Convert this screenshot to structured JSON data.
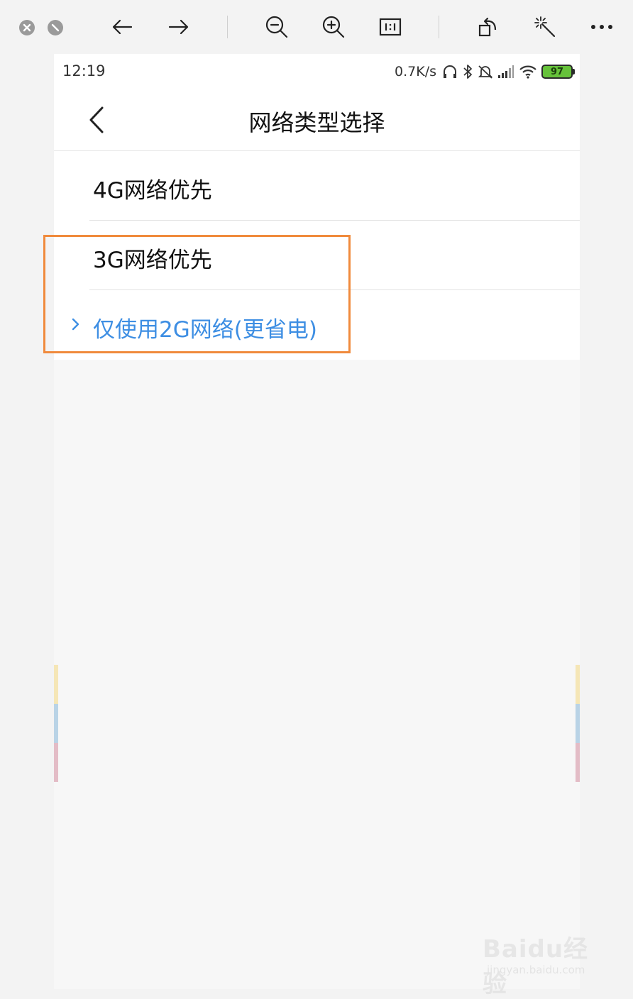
{
  "viewer": {
    "toolbar": {
      "buttons": [
        "close-icon",
        "minimize-icon",
        "arrow-left-icon",
        "arrow-right-icon",
        "zoom-out-icon",
        "zoom-in-icon",
        "actual-size-icon",
        "rotate-icon",
        "magic-wand-icon",
        "more-icon"
      ]
    }
  },
  "status_bar": {
    "time": "12:19",
    "net_speed": "0.7K/s",
    "battery": "97",
    "icons": [
      "headphones-icon",
      "bluetooth-icon",
      "mute-bell-icon",
      "signal-icon",
      "wifi-icon"
    ]
  },
  "header": {
    "title": "网络类型选择"
  },
  "options": [
    {
      "label": "4G网络优先",
      "selected": false
    },
    {
      "label": "3G网络优先",
      "selected": false
    },
    {
      "label": "仅使用2G网络(更省电)",
      "selected": true
    }
  ],
  "colors": {
    "selected": "#3d8ee3",
    "highlight_border": "#f08a3c",
    "battery": "#66c23a"
  },
  "watermark": {
    "main": "Baidu经验",
    "sub": "jingyan.baidu.com"
  }
}
